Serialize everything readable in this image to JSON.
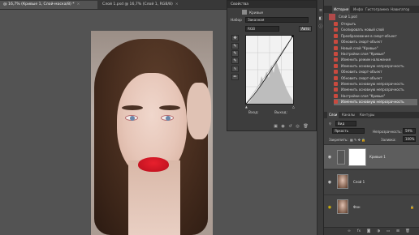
{
  "document_tabs": [
    {
      "label": "@ 16,7% (Кривые 1, Слой-маска/8) *",
      "active": true
    },
    {
      "label": "Слой 1.psd @ 16,7% (Слой 1, RGB/8)",
      "active": false
    }
  ],
  "properties": {
    "title": "Свойства",
    "adjustment": "Кривые",
    "preset_label": "Набор",
    "preset_value": "Заказная",
    "channel": "RGB",
    "auto_button": "Авто",
    "input_label": "Вход:",
    "output_label": "Выход:"
  },
  "right_panel": {
    "tabs": [
      "История",
      "Инфо",
      "Гистограмма",
      "Навигатор"
    ],
    "active_tab": "История",
    "file_name": "Слой 1.psd",
    "history": [
      {
        "label": "Открыть",
        "selected": false
      },
      {
        "label": "Скопировать новый слой",
        "selected": false
      },
      {
        "label": "Преобразование в смарт-объект",
        "selected": false
      },
      {
        "label": "Обновить смарт-объект",
        "selected": false
      },
      {
        "label": "Новый слой \"Кривые\"",
        "selected": false
      },
      {
        "label": "Настройки слоя \"Кривые\"",
        "selected": false
      },
      {
        "label": "Изменить режим наложения",
        "selected": false
      },
      {
        "label": "Изменить основную непрозрачность",
        "selected": false
      },
      {
        "label": "Обновить смарт-объект",
        "selected": false
      },
      {
        "label": "Обновить смарт-объект",
        "selected": false
      },
      {
        "label": "Изменить основную непрозрачность",
        "selected": false
      },
      {
        "label": "Изменить основную непрозрачность",
        "selected": false
      },
      {
        "label": "Настройки слоя \"Кривые\"",
        "selected": false
      },
      {
        "label": "Изменить основную непрозрачность",
        "selected": true
      }
    ]
  },
  "layers_panel": {
    "tabs": [
      "Слои",
      "Каналы",
      "Контуры"
    ],
    "active_tab": "Слои",
    "filter_label": "Вид",
    "blend_mode": "Яркость",
    "opacity_label": "Непрозрачность:",
    "opacity_value": "59%",
    "lock_label": "Закрепить:",
    "fill_label": "Заливка:",
    "fill_value": "100%",
    "layers": [
      {
        "name": "Кривые 1",
        "type": "adjustment"
      },
      {
        "name": "Слой 1",
        "type": "smart"
      },
      {
        "name": "Фон",
        "type": "background"
      }
    ]
  },
  "colors": {
    "workspace": "#535353",
    "panel": "#424242",
    "selection": "#6a6a6a",
    "history_icon": "#c94a3f"
  },
  "icons": [
    "close-icon",
    "eyedropper-icon",
    "pencil-icon",
    "eye-icon",
    "lock-icon",
    "link-icon",
    "trash-icon",
    "new-layer-icon",
    "folder-icon",
    "mask-icon",
    "fx-icon",
    "camera-icon"
  ]
}
